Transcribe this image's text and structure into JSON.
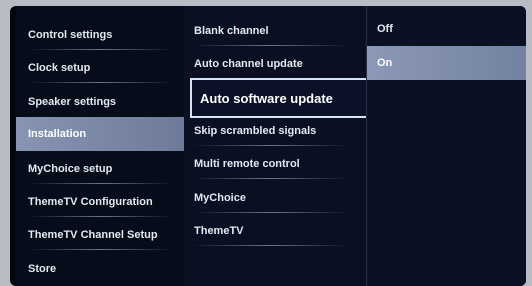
{
  "menu": {
    "settings": [
      {
        "label": "Control settings"
      },
      {
        "label": "Clock setup"
      },
      {
        "label": "Speaker settings"
      },
      {
        "label": "Installation",
        "selected": true
      },
      {
        "label": "MyChoice setup"
      },
      {
        "label": "ThemeTV Configuration"
      },
      {
        "label": "ThemeTV Channel Setup"
      },
      {
        "label": "Store"
      }
    ],
    "installation_options": [
      {
        "label": "Blank channel"
      },
      {
        "label": "Auto channel update"
      },
      {
        "label": "Auto software update",
        "focused": true
      },
      {
        "label": "Skip scrambled signals"
      },
      {
        "label": "Multi remote control"
      },
      {
        "label": "MyChoice"
      },
      {
        "label": "ThemeTV"
      }
    ],
    "values": [
      {
        "label": "Off"
      },
      {
        "label": "On",
        "selected": true
      }
    ]
  },
  "colors": {
    "background": "#03060f",
    "selection": "#7b88a8",
    "focus_border": "#d6e3f5",
    "text": "#e4e8f0"
  }
}
